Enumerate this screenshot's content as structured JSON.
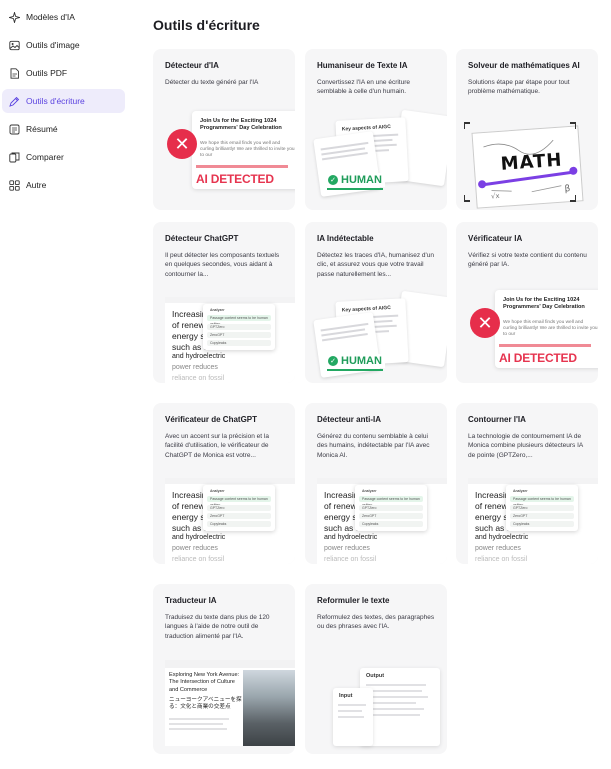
{
  "sidebar": {
    "items": [
      {
        "label": "Modèles d'IA",
        "icon": "sparkle-icon"
      },
      {
        "label": "Outils d'image",
        "icon": "image-icon"
      },
      {
        "label": "Outils PDF",
        "icon": "pdf-icon"
      },
      {
        "label": "Outils d'écriture",
        "icon": "pen-icon",
        "active": true
      },
      {
        "label": "Résumé",
        "icon": "summary-icon"
      },
      {
        "label": "Comparer",
        "icon": "compare-icon"
      },
      {
        "label": "Autre",
        "icon": "grid-icon"
      }
    ]
  },
  "page_title": "Outils d'écriture",
  "colors": {
    "accent": "#5b43e0",
    "active_bg": "#eeecfb",
    "danger": "#e62e4b",
    "success": "#23a862",
    "math_purple": "#7b3fe4"
  },
  "cards": [
    {
      "title": "Détecteur d'IA",
      "desc": "Détecter du texte généré par l'IA",
      "art": "detector"
    },
    {
      "title": "Humaniseur de Texte IA",
      "desc": "Convertissez l'IA en une écriture semblable à celle d'un humain.",
      "art": "human"
    },
    {
      "title": "Solveur de mathématiques AI",
      "desc": "Solutions étape par étape pour tout problème mathématique.",
      "art": "math"
    },
    {
      "title": "Détecteur ChatGPT",
      "desc": "Il peut détecter les composants textuels en quelques secondes, vous aidant à contourner la...",
      "art": "writing"
    },
    {
      "title": "IA Indétectable",
      "desc": "Détectez les traces d'IA, humanisez d'un clic, et assurez vous que votre travail passe naturellement les...",
      "art": "human"
    },
    {
      "title": "Vérificateur IA",
      "desc": "Vérifiez si votre texte contient du contenu généré par IA.",
      "art": "detector"
    },
    {
      "title": "Vérificateur de ChatGPT",
      "desc": "Avec un accent sur la précision et la facilité d'utilisation, le vérificateur de ChatGPT de Monica est votre...",
      "art": "writing"
    },
    {
      "title": "Détecteur anti-IA",
      "desc": "Générez du contenu semblable à celui des humains, indétectable par l'IA avec Monica AI.",
      "art": "writing"
    },
    {
      "title": "Contourner l'IA",
      "desc": "La technologie de contournement IA de Monica combine plusieurs détecteurs IA de pointe (GPTZero,...",
      "art": "writing"
    },
    {
      "title": "Traducteur IA",
      "desc": "Traduisez du texte dans plus de 120 langues à l'aide de notre outil de traduction alimenté par l'IA.",
      "art": "translator"
    },
    {
      "title": "Reformuler le texte",
      "desc": "Reformulez des textes, des paragraphes ou des phrases avec l'IA.",
      "art": "reformulate"
    }
  ],
  "art_text": {
    "detector": {
      "headline": "Join Us for the Exciting 1024 Programmers' Day Celebration",
      "body": "We hope this email finds you well and curling brilliantly! We are thrilled to invite you to our",
      "badge": "AI DETECTED"
    },
    "human": {
      "doc_title": "Key aspects of AIGC",
      "badge": "HUMAN"
    },
    "math": {
      "word": "MATH"
    },
    "writing": {
      "lines": [
        "Increasing",
        "of renewa",
        "energy so",
        "such as s",
        "and hydroelectric",
        "power reduces",
        "reliance on fossil"
      ],
      "popup_title": "Analyzer",
      "popup_rows": [
        "Passage content seems to be human written",
        "GPTZero",
        "ZeroGPT",
        "Copyleaks"
      ]
    },
    "translator": {
      "en": "Exploring New York Avenue: The Intersection of Culture and Commerce",
      "jp": "ニューヨークアベニューを探る：文化と商業の交差点"
    },
    "reformulate": {
      "output": "Output",
      "input": "Input"
    }
  }
}
